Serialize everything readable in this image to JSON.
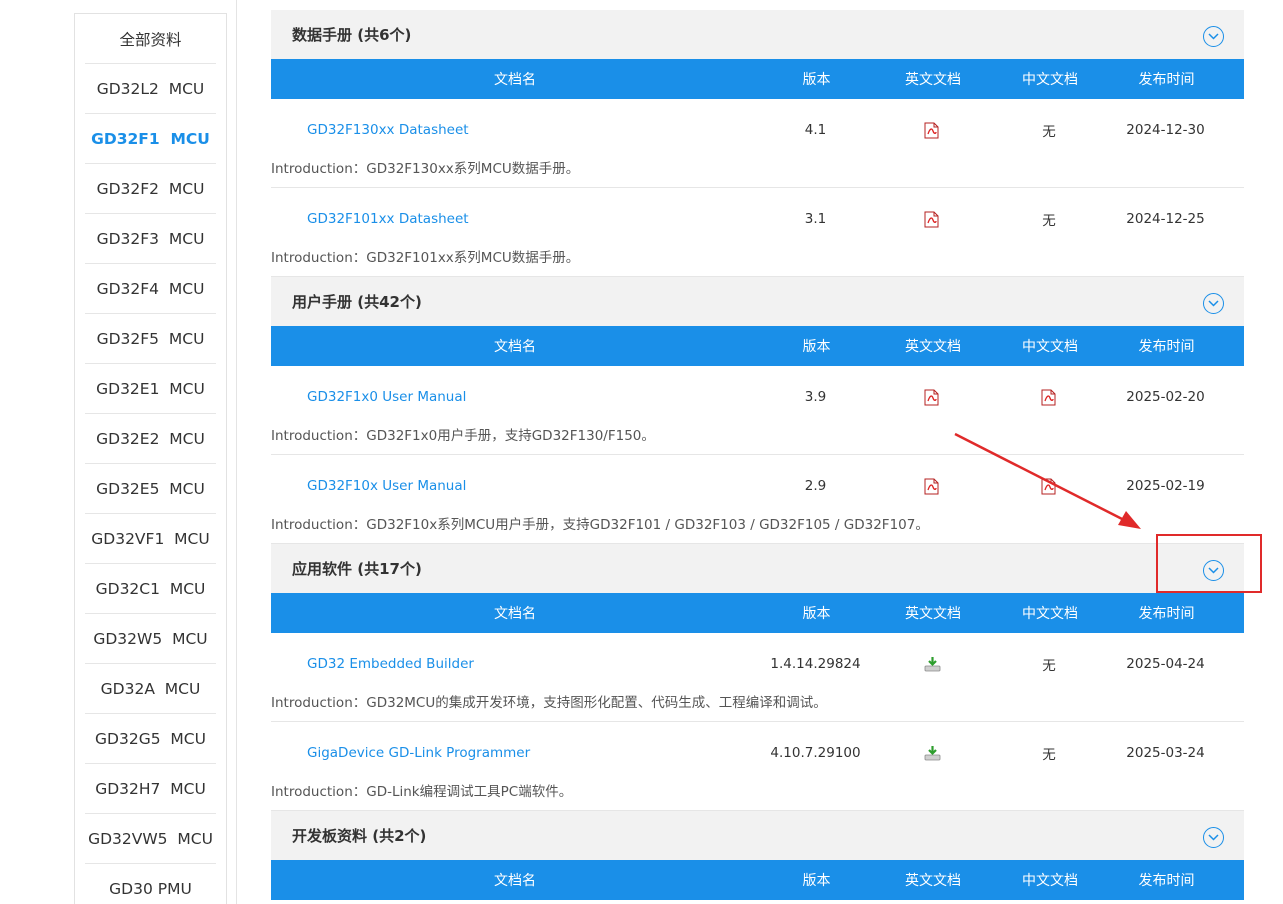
{
  "sidebar": {
    "items": [
      {
        "label": "全部资料"
      },
      {
        "label": "GD32L2  MCU"
      },
      {
        "label": "GD32F1  MCU",
        "active": true
      },
      {
        "label": "GD32F2  MCU"
      },
      {
        "label": "GD32F3  MCU"
      },
      {
        "label": "GD32F4  MCU"
      },
      {
        "label": "GD32F5  MCU"
      },
      {
        "label": "GD32E1  MCU"
      },
      {
        "label": "GD32E2  MCU"
      },
      {
        "label": "GD32E5  MCU"
      },
      {
        "label": "GD32VF1  MCU"
      },
      {
        "label": "GD32C1  MCU"
      },
      {
        "label": "GD32W5  MCU"
      },
      {
        "label": "GD32A  MCU"
      },
      {
        "label": "GD32G5  MCU"
      },
      {
        "label": "GD32H7  MCU"
      },
      {
        "label": "GD32VW5  MCU"
      },
      {
        "label": "GD30 PMU"
      }
    ]
  },
  "table_headers": {
    "name": "文档名",
    "version": "版本",
    "english": "英文文档",
    "chinese": "中文文档",
    "date": "发布时间"
  },
  "sections": [
    {
      "title": "数据手册 (共6个)",
      "rows": [
        {
          "name": "GD32F130xx Datasheet",
          "version": "4.1",
          "en": "pdf-icon",
          "cn": "无",
          "date": "2024-12-30",
          "intro": "Introduction：GD32F130xx系列MCU数据手册。"
        },
        {
          "name": "GD32F101xx Datasheet",
          "version": "3.1",
          "en": "pdf-icon",
          "cn": "无",
          "date": "2024-12-25",
          "intro": "Introduction：GD32F101xx系列MCU数据手册。"
        }
      ]
    },
    {
      "title": "用户手册 (共42个)",
      "rows": [
        {
          "name": "GD32F1x0 User Manual",
          "version": "3.9",
          "en": "pdf-icon",
          "cn": "pdf-icon",
          "date": "2025-02-20",
          "intro": "Introduction：GD32F1x0用户手册，支持GD32F130/F150。"
        },
        {
          "name": "GD32F10x User Manual",
          "version": "2.9",
          "en": "pdf-icon",
          "cn": "pdf-icon",
          "date": "2025-02-19",
          "intro": "Introduction：GD32F10x系列MCU用户手册，支持GD32F101 / GD32F103 / GD32F105 / GD32F107。"
        }
      ]
    },
    {
      "title": "应用软件 (共17个)",
      "rows": [
        {
          "name": "GD32 Embedded Builder",
          "version": "1.4.14.29824",
          "en": "download-icon",
          "cn": "无",
          "date": "2025-04-24",
          "intro": "Introduction：GD32MCU的集成开发环境，支持图形化配置、代码生成、工程编译和调试。"
        },
        {
          "name": "GigaDevice GD-Link Programmer",
          "version": "4.10.7.29100",
          "en": "download-icon",
          "cn": "无",
          "date": "2025-03-24",
          "intro": "Introduction：GD-Link编程调试工具PC端软件。"
        }
      ]
    },
    {
      "title": "开发板资料 (共2个)",
      "rows": []
    }
  ],
  "colors": {
    "accent": "#1a8fe8",
    "section_bg": "#f2f2f2",
    "annotation": "#e02a2a"
  }
}
